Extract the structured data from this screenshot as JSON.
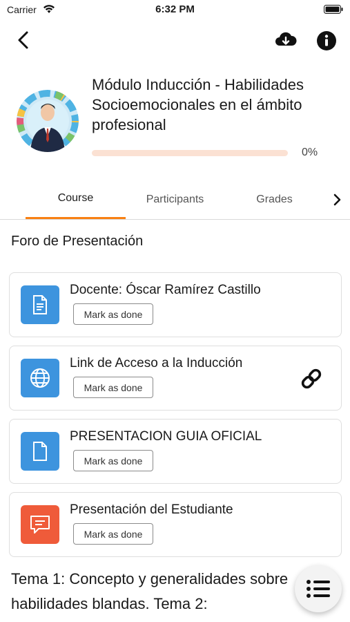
{
  "status_bar": {
    "carrier": "Carrier",
    "time": "6:32 PM"
  },
  "nav": {
    "back_icon": "back-chevron-icon",
    "download_icon": "cloud-download-icon",
    "info_icon": "info-icon"
  },
  "course": {
    "title": "Módulo Inducción - Habilidades Socioemocionales en el ámbito profesional",
    "progress_percent": 0,
    "progress_label": "0%"
  },
  "tabs": [
    {
      "label": "Course",
      "active": true
    },
    {
      "label": "Participants",
      "active": false
    },
    {
      "label": "Grades",
      "active": false
    }
  ],
  "section": {
    "title": "Foro de Presentación",
    "activities": [
      {
        "name": "Docente: Óscar Ramírez Castillo",
        "button": "Mark as done",
        "icon": "document-icon",
        "color": "#3d94de"
      },
      {
        "name": "Link de Acceso a la Inducción",
        "button": "Mark as done",
        "icon": "globe-icon",
        "color": "#3d94de",
        "trailing_icon": "link-icon"
      },
      {
        "name": "PRESENTACION GUIA OFICIAL",
        "button": "Mark as done",
        "icon": "file-icon",
        "color": "#3d94de"
      },
      {
        "name": "Presentación del Estudiante",
        "button": "Mark as done",
        "icon": "forum-icon",
        "color": "#ef5b3a"
      }
    ]
  },
  "next_section_title": "Tema 1: Concepto y generalidades sobre habilidades blandas. Tema 2:",
  "fab_icon": "course-index-icon",
  "colors": {
    "accent": "#f98012",
    "progress_track": "#fbe1d3"
  }
}
